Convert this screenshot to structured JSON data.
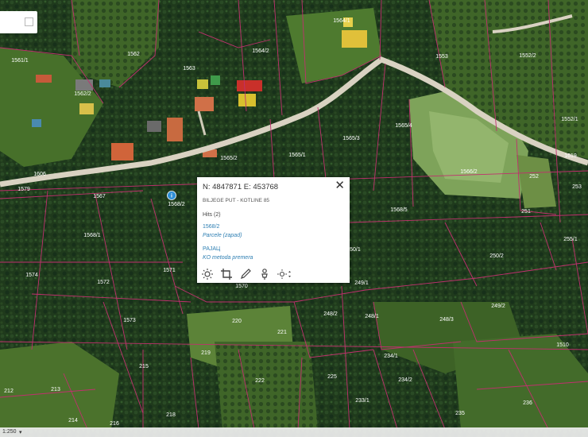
{
  "map": {
    "parcel_labels": [
      "1561/1",
      "1562",
      "1563",
      "1564/1",
      "1564/2",
      "1553",
      "1552/2",
      "1562/2",
      "1565/4",
      "1565/3",
      "1552/1",
      "1565/2",
      "1565/1",
      "1606",
      "1579",
      "1567",
      "1568/2",
      "1566/2",
      "252",
      "1619",
      "253",
      "251",
      "1568/5",
      "1568/1",
      "1574",
      "1572",
      "1571",
      "249/1",
      "250/2",
      "255/1",
      "1570",
      "250/1",
      "1573",
      "249/2",
      "248/2",
      "248/1",
      "248/3",
      "220",
      "221",
      "219",
      "215",
      "1510",
      "234/1",
      "225",
      "222",
      "234/2",
      "212",
      "213",
      "214",
      "218",
      "216",
      "233/1",
      "235",
      "236"
    ],
    "tree_labels": [
      "1565/4",
      "1565/3"
    ]
  },
  "popup": {
    "coords": "N: 4847871 E: 453768",
    "address": "BILJEGE PUT - KOTLINE 85",
    "hits_label": "Hits (2)",
    "result1_id": "1568/2",
    "result1_source": "Parcele (zapad)",
    "result2_id": "РАЈАЦ",
    "result2_source": "KO metoda premera",
    "close_glyph": "✕",
    "tools": [
      "sun-icon",
      "crop-icon",
      "pencil-icon",
      "user-pin-icon",
      "brightness-dropdown-icon"
    ]
  },
  "marker": {
    "symbol": "i"
  },
  "scale": {
    "label": "1:250",
    "caret": "▾"
  },
  "colors": {
    "forest": "#1f3a1c",
    "meadow": "#4f7a2b",
    "field": "#7ea35a",
    "road": "#d9d2c2",
    "boundary": "#c0306e",
    "label": "#ffffff",
    "marker": "#2f8fd6",
    "link": "#2e7fb3"
  }
}
